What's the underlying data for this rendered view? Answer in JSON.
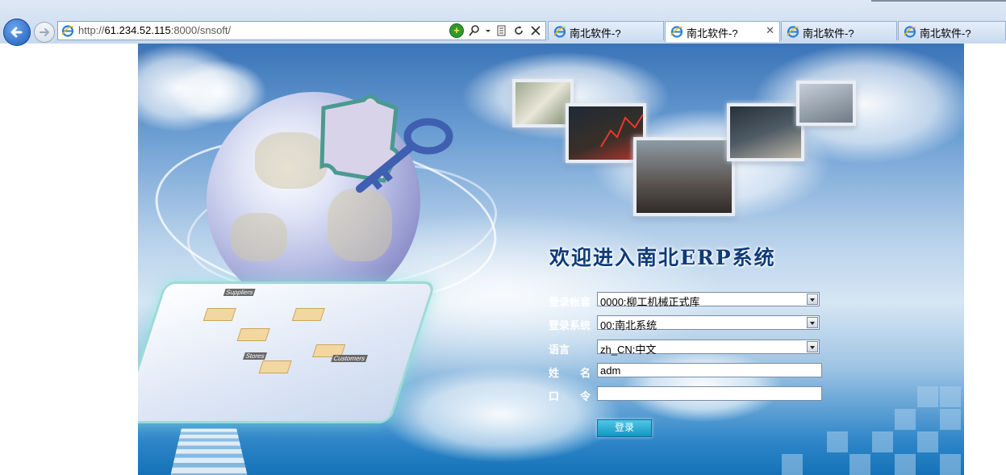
{
  "browser": {
    "url_prefix": "http://",
    "url_host": "61.234.52.115",
    "url_rest": ":8000/snsoft/",
    "tabs": [
      {
        "label": "南北软件-?",
        "active": false
      },
      {
        "label": "南北软件-?",
        "active": true,
        "close": "✕"
      },
      {
        "label": "南北软件-?",
        "active": false
      },
      {
        "label": "南北软件-?",
        "active": false
      }
    ],
    "icons": [
      "back-arrow-icon",
      "forward-arrow-icon",
      "ie-logo-icon",
      "compatibility-icon",
      "search-icon",
      "refresh-icon",
      "stop-icon"
    ]
  },
  "login": {
    "welcome": "欢迎进入南北ERP系统",
    "account_set": {
      "label": "登录帐套",
      "value": "0000:柳工机械正式库"
    },
    "system": {
      "label": "登录系统",
      "value": "00:南北系统"
    },
    "language": {
      "label": "语言",
      "value": "zh_CN:中文"
    },
    "name": {
      "label": "姓　　名",
      "value": "adm"
    },
    "password": {
      "label": "口　　令",
      "value": ""
    },
    "submit": "登录"
  },
  "illustration": {
    "platform_labels": [
      "Suppliers",
      "Stores",
      "Customers"
    ]
  },
  "colors": {
    "accent": "#1395c4",
    "welcome_text": "#0d3b7a",
    "sky": "#6ea0d4"
  }
}
